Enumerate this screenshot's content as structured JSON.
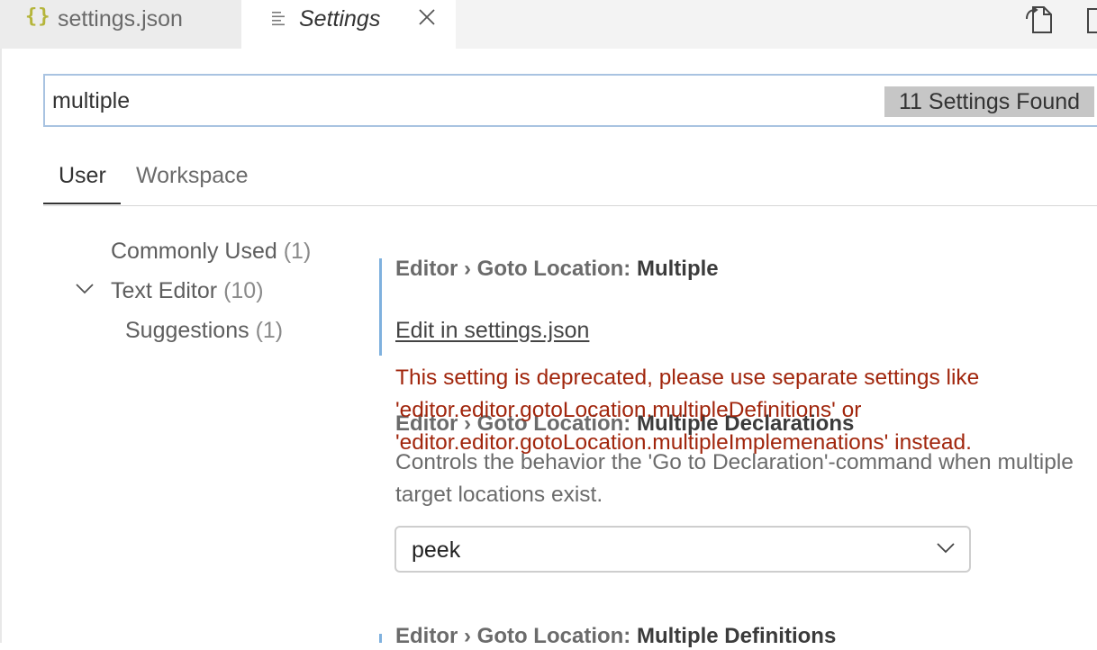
{
  "tabs": {
    "json_tab": {
      "label": "settings.json",
      "icon": "braces-icon"
    },
    "settings_tab": {
      "label": "Settings",
      "icon": "settings-editor-icon"
    }
  },
  "search": {
    "value": "multiple",
    "results_badge": "11 Settings Found"
  },
  "scope_tabs": {
    "user": "User",
    "workspace": "Workspace"
  },
  "toc": {
    "commonly_used": {
      "label": "Commonly Used",
      "count": "(1)"
    },
    "text_editor": {
      "label": "Text Editor",
      "count": "(10)"
    },
    "suggestions": {
      "label": "Suggestions",
      "count": "(1)"
    }
  },
  "settings": [
    {
      "category": "Editor › Goto Location: ",
      "name": "Multiple",
      "edit_link": "Edit in settings.json",
      "deprecation": "This setting is deprecated, please use separate settings like 'editor.editor.gotoLocation.multipleDefinitions' or 'editor.editor.gotoLocation.multipleImplemenations' instead."
    },
    {
      "category": "Editor › Goto Location: ",
      "name": "Multiple Declarations",
      "description": "Controls the behavior the 'Go to Declaration'-command when multiple target locations exist.",
      "value": "peek"
    },
    {
      "category": "Editor › Goto Location: ",
      "name": "Multiple Definitions"
    }
  ],
  "colors": {
    "accent_bar": "#7fb1de",
    "deprecation_text": "#a1260d",
    "search_border": "#a9c3e1"
  }
}
